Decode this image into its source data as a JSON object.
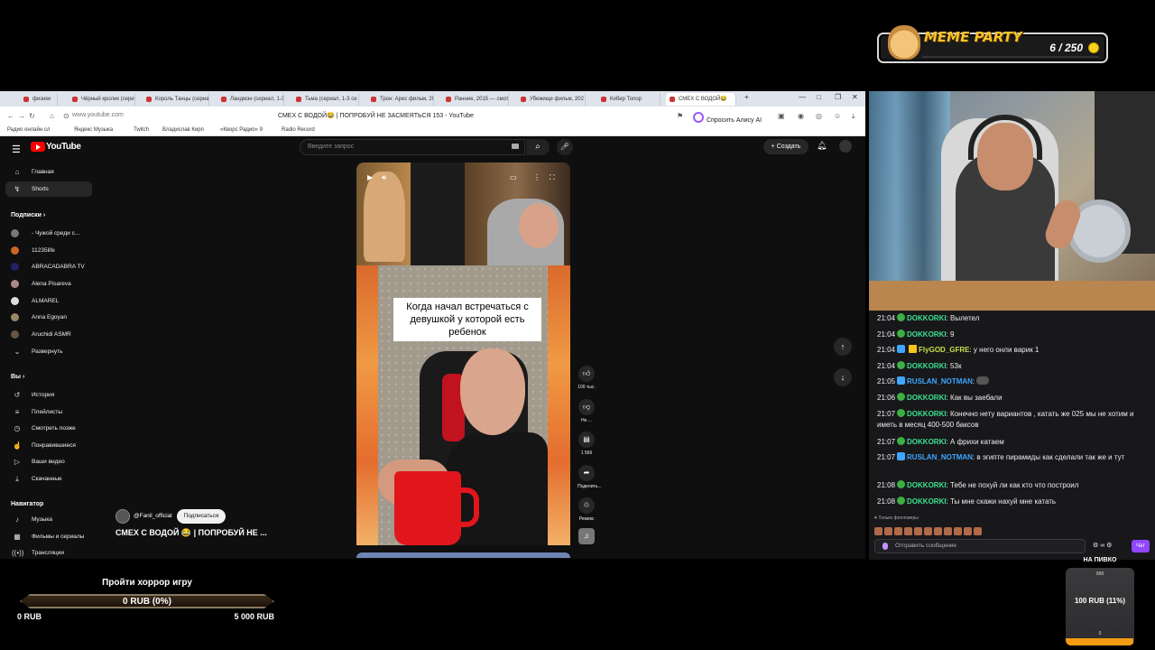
{
  "meme_party": {
    "title": "MEME PARTY",
    "count": "6 / 250"
  },
  "browser": {
    "tabs": [
      {
        "label": "физики"
      },
      {
        "label": "Чёрный кролик (сери"
      },
      {
        "label": "Король Танцы (сериа"
      },
      {
        "label": "Ландмэн (сериал, 1-3"
      },
      {
        "label": "Тьма (сериал, 1-3 се"
      },
      {
        "label": "Трон: Арес фильм, 20"
      },
      {
        "label": "Ранние, 2015 — смотр"
      },
      {
        "label": "Убежище фильм, 202"
      },
      {
        "label": "Кибер Топор"
      },
      {
        "label": "СМЕХ С ВОДОЙ😂"
      }
    ],
    "url": "www.youtube.com",
    "page_title": "СМЕХ С ВОДОЙ😂 | ПОПРОБУЙ НЕ ЗАСМЕЯТЬСЯ 153 - YouTube",
    "alice": "Спросить Алису AI",
    "bookmarks": [
      {
        "label": "Радио онлайн сл"
      },
      {
        "label": "Яндекс Музыка"
      },
      {
        "label": "Twitch"
      },
      {
        "label": "Владислав Кирп"
      },
      {
        "label": "«Кворс Радио» 9"
      },
      {
        "label": "Radio Record"
      }
    ]
  },
  "youtube": {
    "logo": "YouTube",
    "search_placeholder": "Введите запрос",
    "create": "Создать",
    "sidebar": {
      "main": [
        {
          "label": "Главная"
        },
        {
          "label": "Shorts"
        }
      ],
      "subs_title": "Подписки",
      "subs": [
        {
          "label": "- Чужой среди с..."
        },
        {
          "label": "11235life"
        },
        {
          "label": "ABRACADABRA TV"
        },
        {
          "label": "Alena Pisareva"
        },
        {
          "label": "ALMAREL"
        },
        {
          "label": "Anna Egoyan"
        },
        {
          "label": "Aruchidi ASMR"
        },
        {
          "label": "Развернуть"
        }
      ],
      "you_title": "Вы",
      "you": [
        {
          "label": "История"
        },
        {
          "label": "Плейлисты"
        },
        {
          "label": "Смотреть позже"
        },
        {
          "label": "Понравившиеся"
        },
        {
          "label": "Ваши видео"
        },
        {
          "label": "Скачанные"
        }
      ],
      "nav_title": "Навигатор",
      "nav": [
        {
          "label": "Музыка"
        },
        {
          "label": "Фильмы и сериалы"
        },
        {
          "label": "Трансляции"
        }
      ]
    },
    "short": {
      "caption": "Когда начал встречаться с девушкой у которой есть ребенок",
      "likes": "100 тыс.",
      "dislike": "Не ...",
      "comments": "1 566",
      "share": "Поделить...",
      "remix": "Ремикс"
    },
    "channel": {
      "name": "@Fanil_official",
      "subscribe": "Подписаться"
    },
    "video_title": "СМЕХ С ВОДОЙ 😂 | ПОПРОБУЙ НЕ ..."
  },
  "chat": {
    "messages": [
      {
        "time": "21:04",
        "user": "DOKKORKI",
        "color": "#3ce08f",
        "text": ": Вылетел"
      },
      {
        "time": "21:04",
        "user": "DOKKORKI",
        "color": "#3ce08f",
        "text": ": 9"
      },
      {
        "time": "21:04",
        "user": "FlyGOD_GFRE",
        "color": "#c7e24a",
        "text": ": у него онли варик 1"
      },
      {
        "time": "21:04",
        "user": "DOKKORKI",
        "color": "#3ce08f",
        "text": ": 53к"
      },
      {
        "time": "21:05",
        "user": "RUSLAN_NOTMAN",
        "color": "#3ea6ff",
        "text": ":"
      },
      {
        "time": "21:06",
        "user": "DOKKORKI",
        "color": "#3ce08f",
        "text": ": Как вы заебали"
      },
      {
        "time": "21:07",
        "user": "DOKKORKI",
        "color": "#3ce08f",
        "text": ": Конечно нету вариантов , катать же 025 мы не хотим и иметь в месяц 400-500 баксов"
      },
      {
        "time": "21:07",
        "user": "DOKKORKI",
        "color": "#3ce08f",
        "text": ": А фрихи катаем"
      },
      {
        "time": "21:07",
        "user": "RUSLAN_NOTMAN",
        "color": "#3ea6ff",
        "text": ": в эгипте пирамиды как сделали так же и тут"
      },
      {
        "time": "21:08",
        "user": "DOKKORKI",
        "color": "#3ce08f",
        "text": ": Тебе не похуй ли как кто что построил"
      },
      {
        "time": "21:08",
        "user": "DOKKORKI",
        "color": "#3ce08f",
        "text": ": Ты мне скажи нахуй мне катать"
      }
    ],
    "followers_only": "♥ Только фолловеры",
    "input_placeholder": "Отправить сообщение",
    "send": "Чат"
  },
  "horror_goal": {
    "title": "Пройти хоррор игру",
    "current": "0 RUB (0%)",
    "min": "0 RUB",
    "max": "5 000 RUB",
    "progress": 0
  },
  "beer_goal": {
    "title": "НА ПИВКО",
    "goal": "888",
    "current": "100 RUB (11%)",
    "zero": "0",
    "progress": 0.11
  }
}
